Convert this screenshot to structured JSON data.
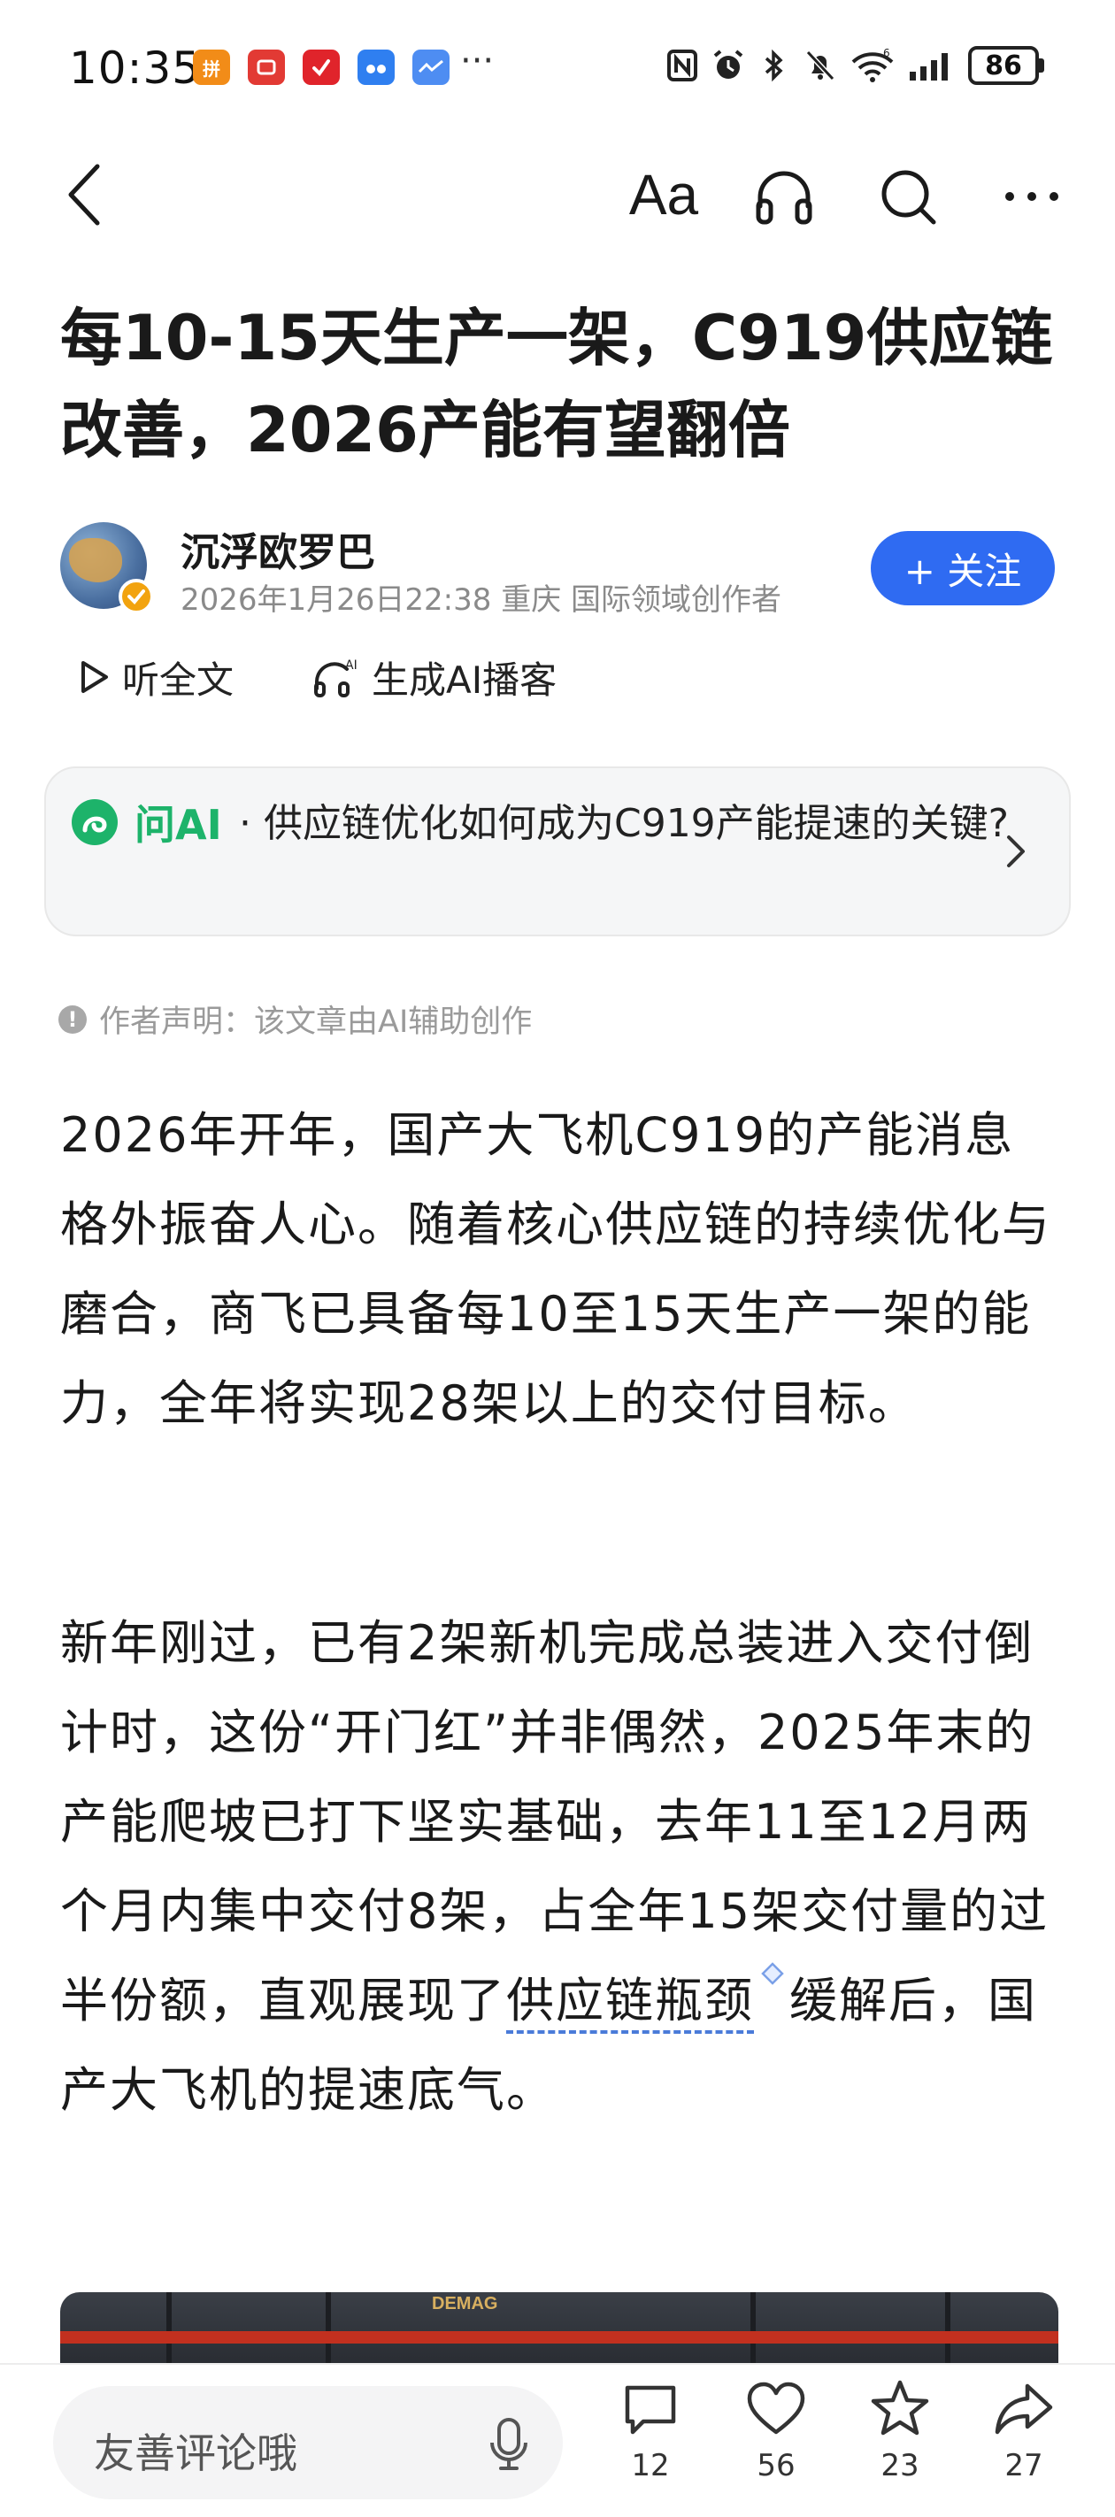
{
  "status_bar": {
    "time": "10:35",
    "more": "···",
    "app_icons": [
      {
        "name": "pinduoduo-icon",
        "color": "#f28c18",
        "glyph": "拼"
      },
      {
        "name": "red-app-icon",
        "color": "#e23a34",
        "glyph": "▢"
      },
      {
        "name": "pocket-app-icon",
        "color": "#e0242b",
        "glyph": "✓"
      },
      {
        "name": "car-home-icon",
        "color": "#2f7ff0",
        "glyph": ""
      },
      {
        "name": "stock-app-icon",
        "color": "#4e8df2",
        "glyph": "∿"
      }
    ],
    "battery": "86",
    "network": "6"
  },
  "nav": {
    "font_label": "Aa"
  },
  "article": {
    "title": "每10-15天生产一架，C919供应链改善，2026产能有望翻倍",
    "author": {
      "name": "沉浮欧罗巴",
      "meta": "2026年1月26日22:38 重庆 国际领域创作者",
      "follow_label": "+ 关注"
    },
    "audio": {
      "listen_label": "听全文",
      "podcast_label": "生成AI播客"
    },
    "ask_ai": {
      "label": "问AI",
      "question": "· 供应链优化如何成为C919产能提速的关键?"
    },
    "statement": "作者声明：该文章由AI辅助创作",
    "paragraphs": {
      "p1": "2026年开年，国产大飞机C919的产能消息格外振奋人心。随着核心供应链的持续优化与磨合，商飞已具备每10至15天生产一架的能力，全年将实现28架以上的交付目标。",
      "p2_a": "新年刚过，已有2架新机完成总装进入交付倒计时，这份“开门红”并非偶然，2025年末的产能爬坡已打下坚实基础，去年11至12月两个月内集中交付8架，占全年15架交付量的过半份额，直观展现了",
      "p2_keyword": "供应链瓶颈",
      "p2_b": "缓解后，国产大飞机的提速底气。"
    },
    "image_text": "DEMAG"
  },
  "bottom_bar": {
    "comment_placeholder": "友善评论哦",
    "comments": "12",
    "likes": "56",
    "favorites": "23",
    "shares": "27"
  },
  "colors": {
    "accent": "#2f6bf2",
    "ask_ai_green": "#1db36a",
    "keyword_underline": "#4a7bd9",
    "meta_gray": "#8a8a8a"
  }
}
